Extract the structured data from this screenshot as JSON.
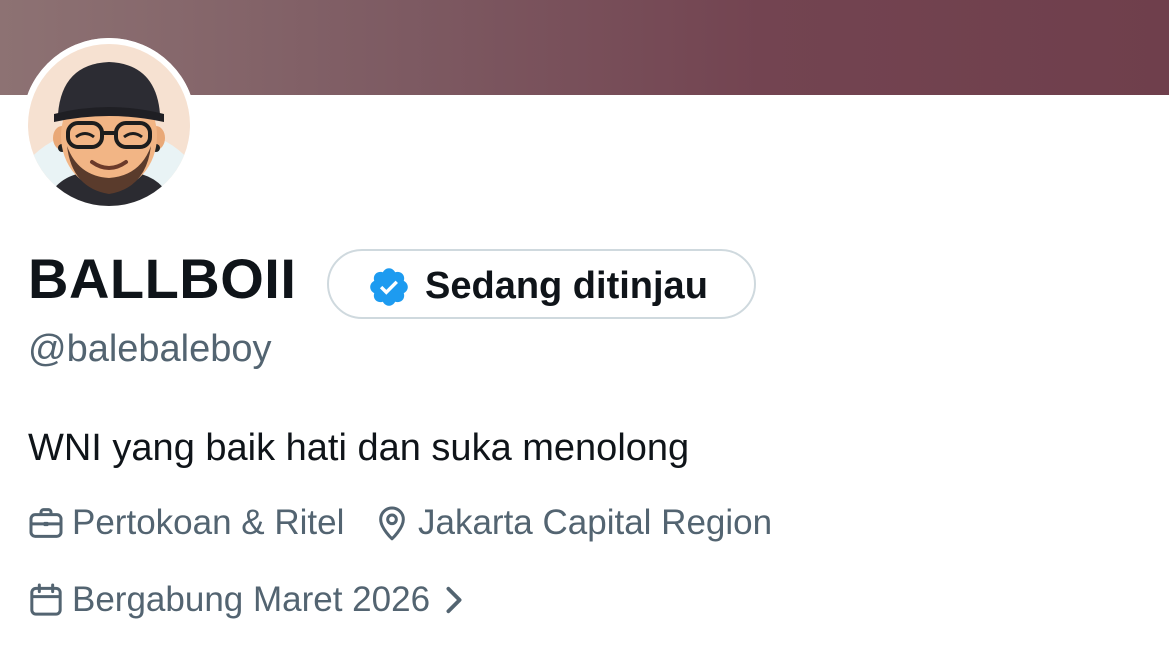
{
  "profile": {
    "display_name": "BALLBOII",
    "verification_label": "Sedang ditinjau",
    "handle": "@balebaleboy",
    "bio": "WNI yang baik hati dan suka menolong",
    "category": "Pertokoan & Ritel",
    "location": "Jakarta Capital Region",
    "joined": "Bergabung Maret 2026"
  },
  "icons": {
    "verified_badge": "verified-badge-icon",
    "category": "briefcase-icon",
    "location": "map-pin-icon",
    "joined": "calendar-icon",
    "expand": "chevron-right-icon"
  },
  "colors": {
    "text_primary": "#0f1419",
    "text_secondary": "#536471",
    "verified_blue": "#1d9bf0",
    "pill_border": "#cfd9de",
    "banner": "#734451"
  }
}
